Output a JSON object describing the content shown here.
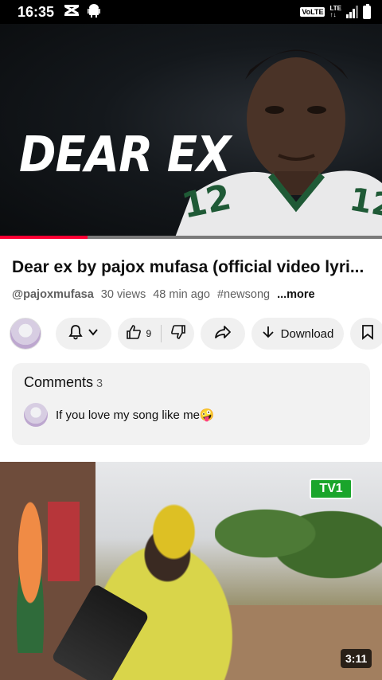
{
  "status_bar": {
    "time": "16:35",
    "volte": "VoLTE",
    "lte": "LTE"
  },
  "video": {
    "overlay_text": "DEAR EX",
    "progress_fraction": 0.23
  },
  "details": {
    "title": "Dear ex by pajox mufasa (official video lyri...",
    "channel": "@pajoxmufasa",
    "views": "30 views",
    "age": "48 min ago",
    "hashtag": "#newsong",
    "more_label": "...more"
  },
  "actions": {
    "like_count": "9",
    "download_label": "Download"
  },
  "comments": {
    "heading": "Comments",
    "count": "3",
    "top_comment": "If you love my song like me🤪"
  },
  "next_video": {
    "channel_logo": "TV1",
    "duration": "3:11"
  },
  "colors": {
    "accent": "#ff0033",
    "pill_bg": "#f0f0f0"
  }
}
